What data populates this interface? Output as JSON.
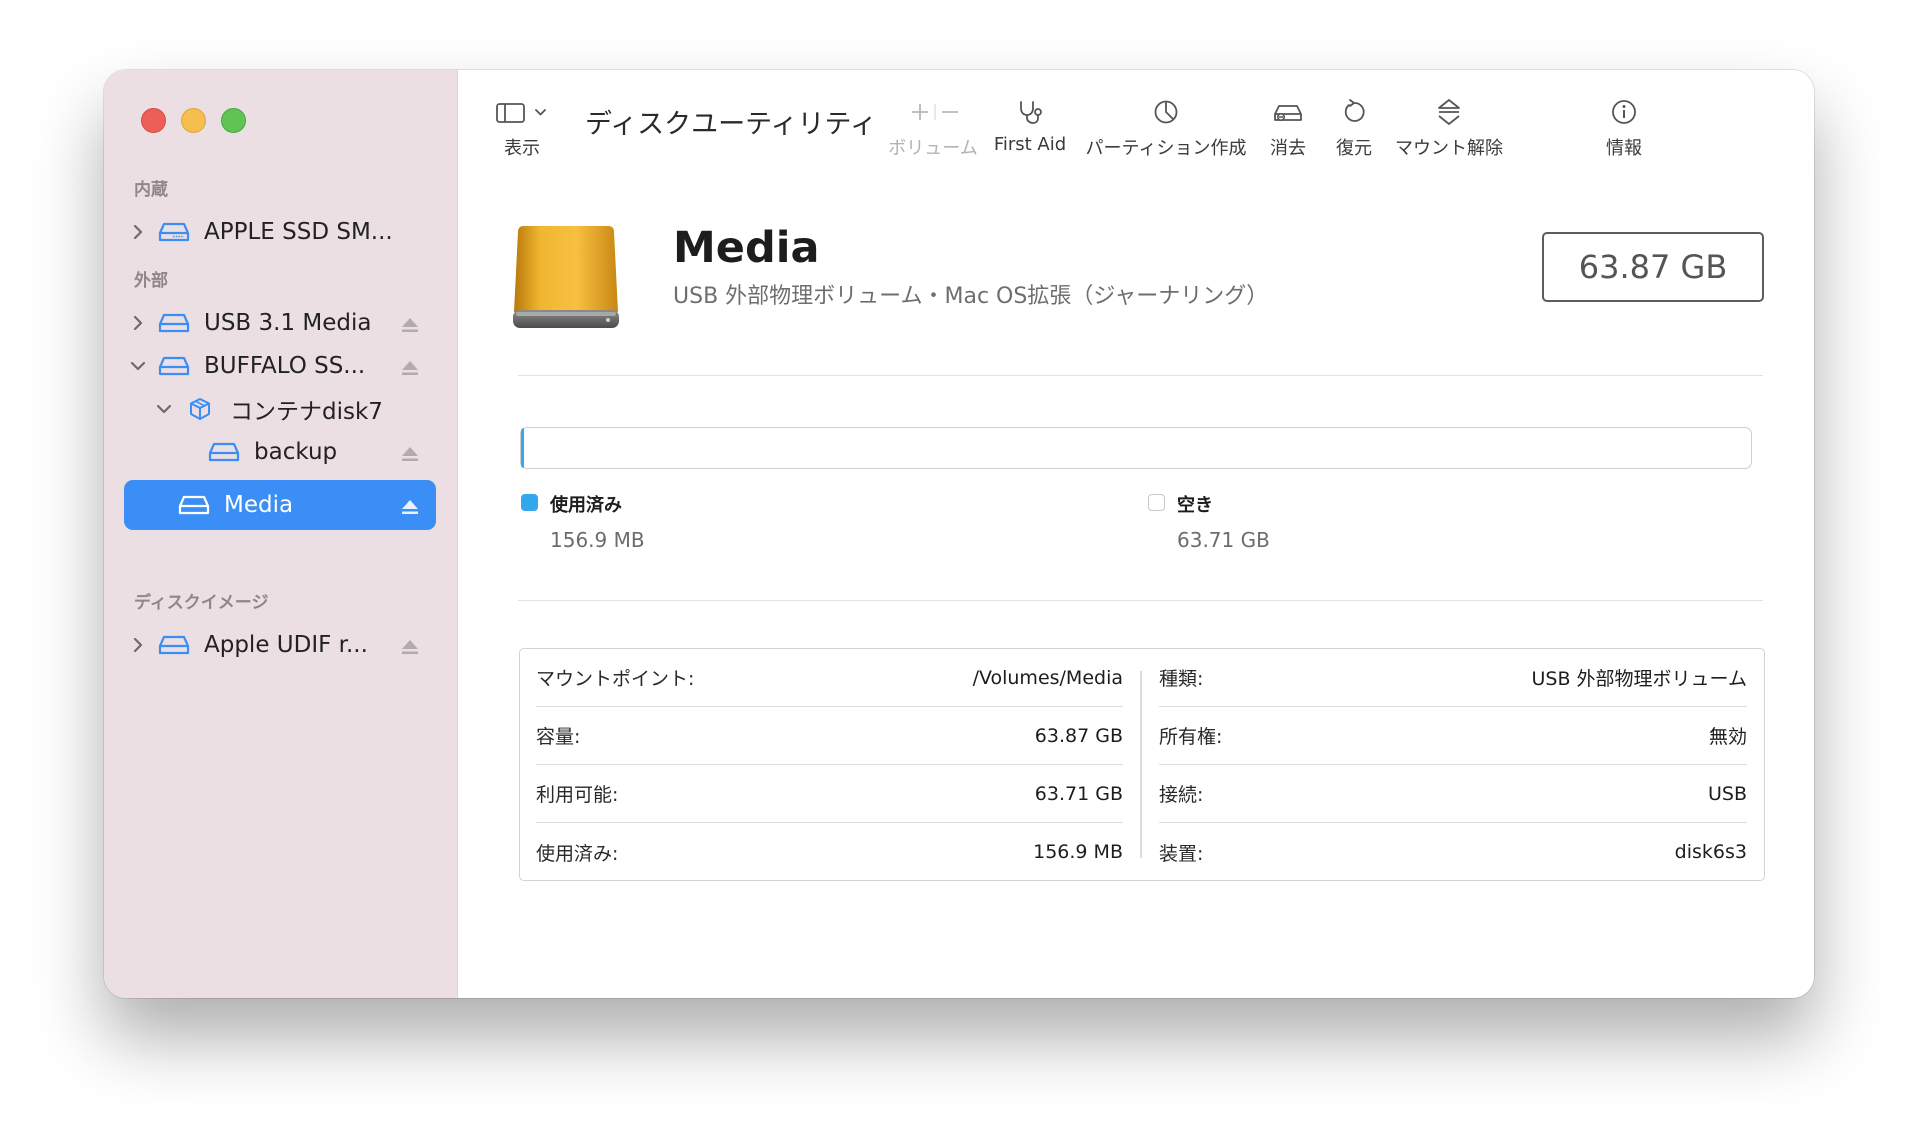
{
  "sidebar": {
    "sections": {
      "internal": "内蔵",
      "external": "外部",
      "disk_images": "ディスクイメージ"
    },
    "items": [
      {
        "label": "APPLE SSD SM..."
      },
      {
        "label": "USB 3.1 Media"
      },
      {
        "label": "BUFFALO SS..."
      },
      {
        "label": "コンテナdisk7"
      },
      {
        "label": "backup"
      },
      {
        "label": "Media"
      },
      {
        "label": "Apple UDIF r..."
      }
    ],
    "selected_color": "#3a8ef5"
  },
  "toolbar": {
    "view_label": "表示",
    "app_title": "ディスクユーティリティ",
    "volume_label": "ボリューム",
    "first_aid_label": "First Aid",
    "partition_label": "パーティション作成",
    "erase_label": "消去",
    "restore_label": "復元",
    "unmount_label": "マウント解除",
    "info_label": "情報"
  },
  "volume": {
    "name": "Media",
    "subtitle": "USB 外部物理ボリューム・Mac OS拡張（ジャーナリング）",
    "size": "63.87 GB"
  },
  "usage": {
    "used_fraction": 0.0025,
    "used_color": "#33a8ef",
    "used_label": "使用済み",
    "used_value": "156.9 MB",
    "free_label": "空き",
    "free_value": "63.71 GB"
  },
  "details": {
    "left": [
      {
        "key": "マウントポイント:",
        "value": "/Volumes/Media"
      },
      {
        "key": "容量:",
        "value": "63.87 GB"
      },
      {
        "key": "利用可能:",
        "value": "63.71 GB"
      },
      {
        "key": "使用済み:",
        "value": "156.9 MB"
      }
    ],
    "right": [
      {
        "key": "種類:",
        "value": "USB 外部物理ボリューム"
      },
      {
        "key": "所有権:",
        "value": "無効"
      },
      {
        "key": "接続:",
        "value": "USB"
      },
      {
        "key": "装置:",
        "value": "disk6s3"
      }
    ]
  }
}
